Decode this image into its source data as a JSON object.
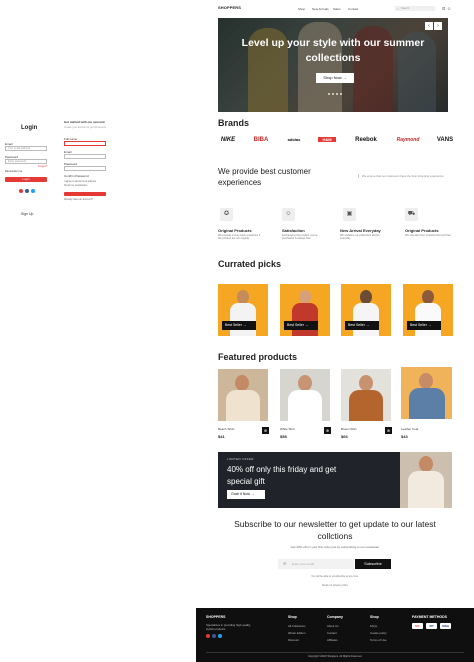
{
  "login": {
    "title": "Login",
    "email_label": "Email",
    "email_placeholder": "Your email address",
    "password_label": "Password",
    "password_placeholder": "Enter password",
    "forgot": "Forgot?",
    "remember": "Remember me",
    "button": "Login",
    "signup_link": "Sign Up"
  },
  "signup": {
    "title": "Get started with our account",
    "subtitle": "Create your account to get full access",
    "name_label": "Full name",
    "email_label": "Email",
    "password_label": "Password",
    "confirm_label": "Confirm Password",
    "check1": "I agree to all terms & policies",
    "check2": "Send me newsletters",
    "link": "Already have an account?"
  },
  "nav": {
    "logo": "SHOPPERS",
    "links": [
      "Shop",
      "New Arrivals",
      "Sales",
      "Contact"
    ],
    "search_placeholder": "Search"
  },
  "hero": {
    "title": "Level up your style with our summer collections",
    "button": "Shop Now →",
    "prev": "‹",
    "next": "›"
  },
  "brands": {
    "title": "Brands",
    "items": [
      "NIKE",
      "BIBA",
      "adidas",
      "H&M",
      "Reebok",
      "Raymond",
      "VANS"
    ]
  },
  "experience": {
    "title": "We provide best customer experiences",
    "text": "We ensure that our customers have the best shopping experience"
  },
  "features": [
    {
      "icon": "badge-icon",
      "title": "Original Products",
      "desc": "We provide money back guarantee if the product are not original"
    },
    {
      "icon": "smile-icon",
      "title": "Satisfaction",
      "desc": "Exchanging the product you've purchased is always free"
    },
    {
      "icon": "box-icon",
      "title": "New Arrival Everyday",
      "desc": "We updates our collections almost everyday"
    },
    {
      "icon": "truck-icon",
      "title": "Original Products",
      "desc": "We ship all of our products fast and free"
    }
  ],
  "picks": {
    "title": "Currated picks",
    "items": [
      {
        "label": "Best Seller →"
      },
      {
        "label": "Best Seller →"
      },
      {
        "label": "Best Seller →"
      },
      {
        "label": "Best Seller →"
      }
    ]
  },
  "featured": {
    "title": "Featured products",
    "items": [
      {
        "name": "Beach Tshirt",
        "price": "$41"
      },
      {
        "name": "White Shirt",
        "price": "$58"
      },
      {
        "name": "Brown Shirt",
        "price": "$66"
      },
      {
        "name": "Leather Coat",
        "price": "$43"
      }
    ]
  },
  "offer": {
    "label": "LIMITED OFFER",
    "title": "40% off only this friday and get special gift",
    "button": "Grab it Now →"
  },
  "newsletter": {
    "title": "Subscribe to our newsletter to get update to our latest collctions",
    "subtitle": "Get 20% off on your first order just by subscribing to our newsletter",
    "placeholder": "Enter your email",
    "button": "Subscribe",
    "note": "You will be able to unsubscribe at any time.",
    "privacy": "Read our privacy policy"
  },
  "footer": {
    "logo": "SHOPPERS",
    "desc": "Specializes in providing high-quality, stylish products",
    "shop_title": "Shop",
    "shop_items": [
      "All Collections",
      "Winter Edition",
      "Discount"
    ],
    "company_title": "Company",
    "company_items": [
      "About Us",
      "Contact",
      "Affiliates"
    ],
    "support_title": "Shop",
    "support_items": [
      "FAQs",
      "Cookie policy",
      "Terms of Use"
    ],
    "payment_title": "PAYMENT METHODS",
    "payments": [
      "MC",
      "PP",
      "VISA"
    ],
    "copyright": "Copyright ©2023 Shoppers. All Rights Reserved."
  }
}
